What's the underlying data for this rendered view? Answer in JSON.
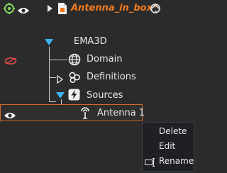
{
  "top": {
    "title": "Antenna_in_box*",
    "title_color": "#f07a1c"
  },
  "tree": {
    "root_label": "EMA3D",
    "items": [
      {
        "label": "Domain",
        "icon": "globe-icon"
      },
      {
        "label": "Definitions",
        "icon": "definitions-icon"
      },
      {
        "label": "Sources",
        "icon": "sources-icon"
      }
    ],
    "child": {
      "label": "Antenna 1",
      "icon": "antenna-icon"
    }
  },
  "context_menu": {
    "items": [
      "Delete",
      "Edit",
      "Rename"
    ]
  },
  "colors": {
    "accent": "#3ab3f0",
    "selection_border": "#d06a2a"
  }
}
